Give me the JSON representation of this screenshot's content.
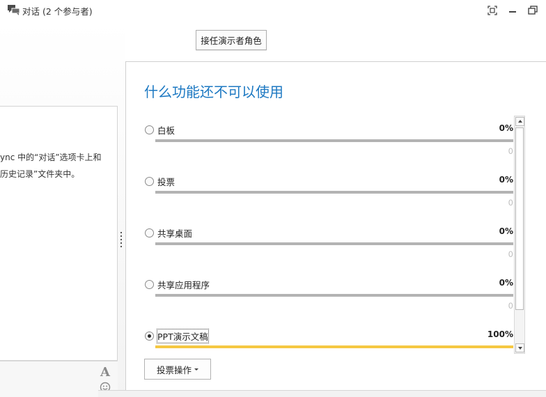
{
  "window": {
    "title": "对话 (2 个参与者)",
    "icons": [
      "conversation-icon",
      "fullscreen-icon",
      "minimize-icon",
      "restore-icon"
    ]
  },
  "toolbar": {
    "take_presenter_label": "接任演示者角色"
  },
  "chat": {
    "line1": "ync 中的“对话”选项卡上和",
    "line2": "历史记录”文件夹中。",
    "compose_icons": [
      "font-icon",
      "emoticon-icon"
    ],
    "font_glyph": "A"
  },
  "poll": {
    "title": "什么功能还不可以使用",
    "options": [
      {
        "label": "白板",
        "percent": "0%",
        "count": "0",
        "fraction": 0,
        "selected": false
      },
      {
        "label": "投票",
        "percent": "0%",
        "count": "0",
        "fraction": 0,
        "selected": false
      },
      {
        "label": "共享桌面",
        "percent": "0%",
        "count": "0",
        "fraction": 0,
        "selected": false
      },
      {
        "label": "共享应用程序",
        "percent": "0%",
        "count": "0",
        "fraction": 0,
        "selected": false
      },
      {
        "label": "PPT演示文稿",
        "percent": "100%",
        "count": "",
        "fraction": 1,
        "selected": true
      }
    ],
    "actions_label": "投票操作",
    "bar_fill_color": "#f5c842",
    "bar_track_color": "#b3b3b3",
    "title_color": "#1c78c2"
  }
}
